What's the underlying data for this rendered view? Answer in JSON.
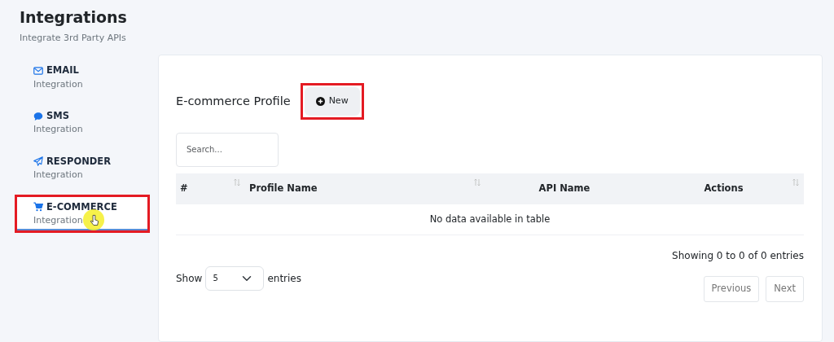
{
  "header": {
    "title": "Integrations",
    "subtitle": "Integrate 3rd Party APIs"
  },
  "sidebar": {
    "items": [
      {
        "kind": "email",
        "label": "EMAIL",
        "sublabel": "Integration",
        "selected": false,
        "highlighted": false
      },
      {
        "kind": "sms",
        "label": "SMS",
        "sublabel": "Integration",
        "selected": false,
        "highlighted": false
      },
      {
        "kind": "responder",
        "label": "RESPONDER",
        "sublabel": "Integration",
        "selected": false,
        "highlighted": false
      },
      {
        "kind": "ecommerce",
        "label": "E-COMMERCE",
        "sublabel": "Integration",
        "selected": true,
        "highlighted": true
      }
    ]
  },
  "panel": {
    "title": "E-commerce Profile",
    "new_button": {
      "label": "New",
      "highlighted": true
    },
    "search": {
      "placeholder": "Search..."
    },
    "table": {
      "columns": [
        {
          "label": "#",
          "sortable": true
        },
        {
          "label": "Profile Name",
          "sortable": true
        },
        {
          "label": "API Name",
          "sortable": false
        },
        {
          "label": "Actions",
          "sortable": true
        }
      ],
      "empty_message": "No data available in table"
    },
    "length": {
      "before": "Show",
      "value": "5",
      "after": "entries"
    },
    "info": "Showing 0 to 0 of 0 entries",
    "pagination": [
      {
        "label": "Previous",
        "disabled": true
      },
      {
        "label": "Next",
        "disabled": true
      }
    ]
  }
}
